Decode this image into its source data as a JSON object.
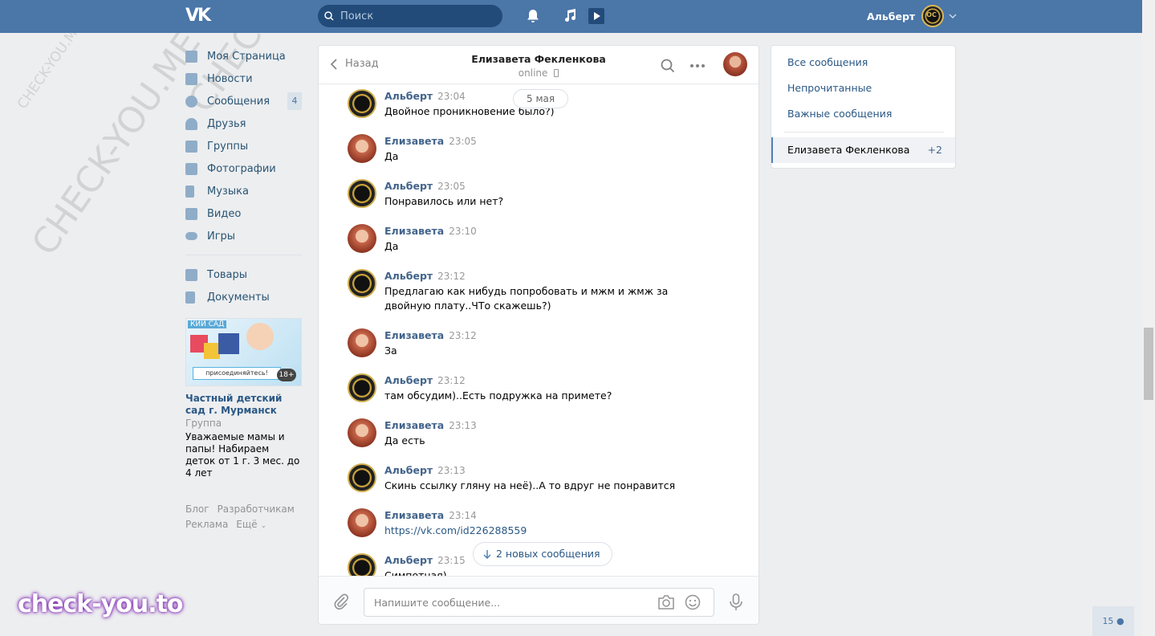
{
  "header": {
    "logo": "VK",
    "search_placeholder": "Поиск",
    "user_name": "Альберт"
  },
  "watermarks": [
    "CHECK-YOU.ME",
    "CHECK-YOU.ME",
    "CHECK-YOU.ME"
  ],
  "sidebar": {
    "items": [
      {
        "label": "Моя Страница",
        "icon": "home-icon"
      },
      {
        "label": "Новости",
        "icon": "news-icon"
      },
      {
        "label": "Сообщения",
        "icon": "messages-icon",
        "badge": "4"
      },
      {
        "label": "Друзья",
        "icon": "friends-icon"
      },
      {
        "label": "Группы",
        "icon": "groups-icon"
      },
      {
        "label": "Фотографии",
        "icon": "camera-icon"
      },
      {
        "label": "Музыка",
        "icon": "music-icon"
      },
      {
        "label": "Видео",
        "icon": "video-icon"
      },
      {
        "label": "Игры",
        "icon": "games-icon"
      }
    ],
    "items2": [
      {
        "label": "Товары",
        "icon": "bag-icon"
      },
      {
        "label": "Документы",
        "icon": "document-icon"
      }
    ],
    "ad": {
      "image_tag": "КИЙ САД",
      "image_banner": "присоединяйтесь!",
      "image_age": "18+",
      "title": "Частный детский сад г. Мурманск",
      "type": "Группа",
      "text": "Уважаемые мамы и папы! Набираем деток от 1 г. 3 мес. до 4 лет"
    },
    "footer": [
      "Блог",
      "Разработчикам",
      "Реклама",
      "Ещё"
    ]
  },
  "chat": {
    "back_label": "Назад",
    "peer_name": "Елизавета Фекленкова",
    "peer_status": "online",
    "date_pill": "5 мая",
    "new_messages": "2 новых сообщения",
    "messages": [
      {
        "author": "Альберт",
        "time": "23:04",
        "text": "Двойное проникновение было?)",
        "side": "albert"
      },
      {
        "author": "Елизавета",
        "time": "23:05",
        "text": "Да",
        "side": "eli"
      },
      {
        "author": "Альберт",
        "time": "23:05",
        "text": "Понравилось или нет?",
        "side": "albert"
      },
      {
        "author": "Елизавета",
        "time": "23:10",
        "text": "Да",
        "side": "eli"
      },
      {
        "author": "Альберт",
        "time": "23:12",
        "text": "Предлагаю как нибудь попробовать и мжм и жмж за двойную плату..ЧТо скажешь?)",
        "side": "albert"
      },
      {
        "author": "Елизавета",
        "time": "23:12",
        "text": "За",
        "side": "eli"
      },
      {
        "author": "Альберт",
        "time": "23:12",
        "text": "там обсудим)..Есть подружка на примете?",
        "side": "albert"
      },
      {
        "author": "Елизавета",
        "time": "23:13",
        "text": "Да есть",
        "side": "eli"
      },
      {
        "author": "Альберт",
        "time": "23:13",
        "text": "Скинь ссылку гляну на неё)..А то вдруг не понравится",
        "side": "albert"
      },
      {
        "author": "Елизавета",
        "time": "23:14",
        "text": "https://vk.com/id226288559",
        "side": "eli"
      },
      {
        "author": "Альберт",
        "time": "23:15",
        "text": "Симпотная)",
        "side": "albert"
      }
    ],
    "composer_placeholder": "Напишите сообщение..."
  },
  "right_panel": {
    "all": "Все сообщения",
    "unread": "Непрочитанные",
    "important": "Важные сообщения",
    "active_chat": "Елизавета Фекленкова",
    "active_count": "+2"
  },
  "brand_watermark": "check-you.to",
  "online_count": "15",
  "colors": {
    "header": "#4a76a8",
    "link": "#2a5885",
    "background": "#edeef0"
  }
}
